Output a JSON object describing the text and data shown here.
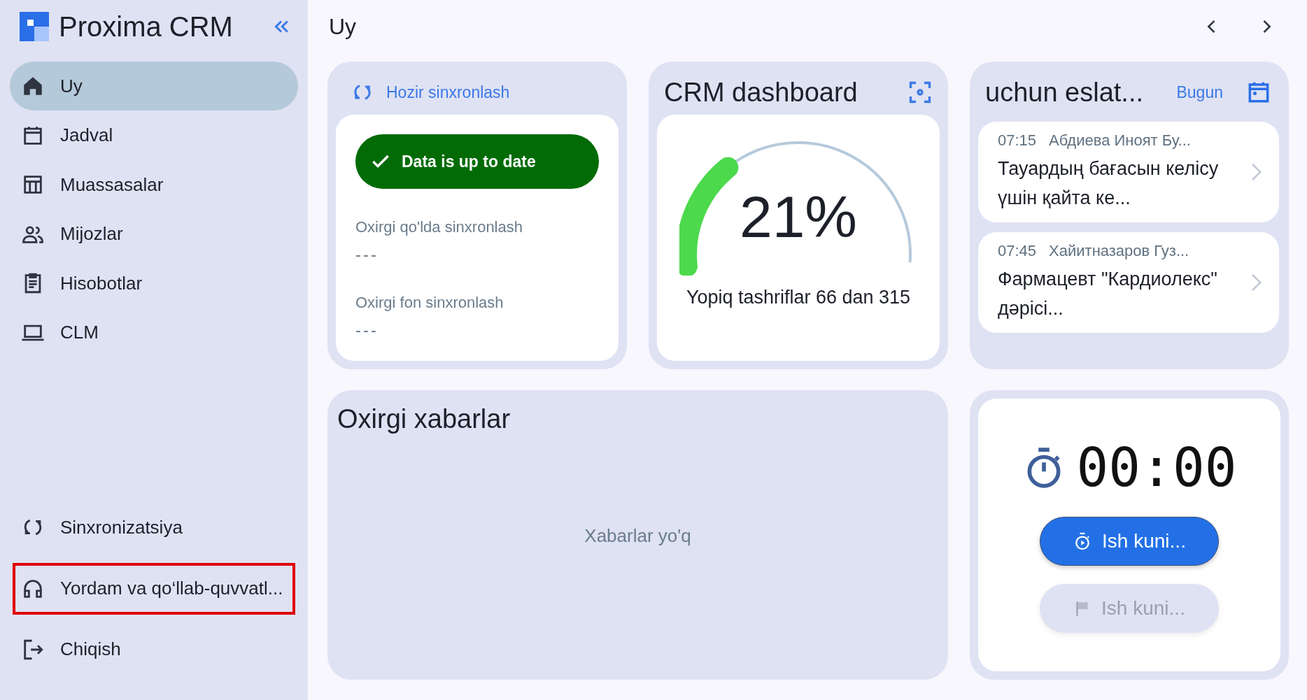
{
  "app": {
    "title": "Proxima CRM"
  },
  "sidebar": {
    "items": [
      {
        "label": "Uy",
        "selected": true
      },
      {
        "label": "Jadval",
        "selected": false
      },
      {
        "label": "Muassasalar",
        "selected": false
      },
      {
        "label": "Mijozlar",
        "selected": false
      },
      {
        "label": "Hisobotlar",
        "selected": false
      },
      {
        "label": "CLM",
        "selected": false
      }
    ],
    "bottom_items": [
      {
        "label": "Sinxronizatsiya",
        "highlighted": false
      },
      {
        "label": "Yordam va qo‘llab-quvvatl...",
        "highlighted": true
      },
      {
        "label": "Chiqish",
        "highlighted": false
      }
    ]
  },
  "header": {
    "title": "Uy"
  },
  "sync_card": {
    "action": "Hozir sinxronlash",
    "status": "Data is up to date",
    "fields": [
      {
        "label": "Oxirgi qo'lda sinxronlash",
        "value": "---"
      },
      {
        "label": "Oxirgi fon sinxronlash",
        "value": "---"
      }
    ]
  },
  "dashboard_card": {
    "title": "CRM dashboard",
    "percent": "21%",
    "caption": "Yopiq tashriflar 66 dan 315"
  },
  "reminders_card": {
    "title": "uchun eslat...",
    "today": "Bugun",
    "items": [
      {
        "time": "07:15",
        "name": "Абдиева Иноят Бу...",
        "text": "Тауардың бағасын келісу үшін қайта ке..."
      },
      {
        "time": "07:45",
        "name": "Хайитназаров Гуз...",
        "text": "Фармацевт \"Кардиолекс\" дәрісі..."
      }
    ]
  },
  "messages_card": {
    "title": "Oxirgi xabarlar",
    "empty_text": "Xabarlar yo'q"
  },
  "timer_card": {
    "time": "00:00",
    "buttons": [
      {
        "label": "Ish kuni...",
        "kind": "start",
        "disabled": false
      },
      {
        "label": "Ish kuni...",
        "kind": "finish",
        "disabled": true
      }
    ]
  }
}
